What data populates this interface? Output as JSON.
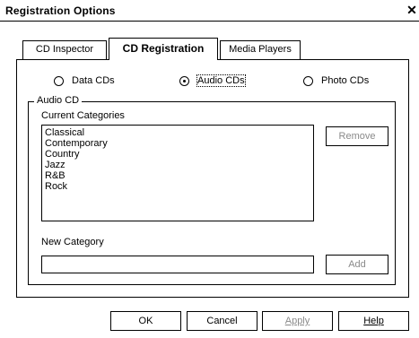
{
  "window": {
    "title": "Registration Options",
    "close_glyph": "✕"
  },
  "tabs": [
    {
      "label": "CD Inspector",
      "active": false
    },
    {
      "label": "CD Registration",
      "active": true
    },
    {
      "label": "Media Players",
      "active": false
    }
  ],
  "disc_type": {
    "options": [
      {
        "label": "Data CDs",
        "checked": false
      },
      {
        "label": "Audio CDs",
        "checked": true
      },
      {
        "label": "Photo CDs",
        "checked": false
      }
    ]
  },
  "audio_cd": {
    "group_label": "Audio CD",
    "current_categories_label": "Current Categories",
    "categories": [
      "Classical",
      "Contemporary",
      "Country",
      "Jazz",
      "R&B",
      "Rock"
    ],
    "remove_label": "Remove",
    "new_category_label": "New Category",
    "new_category_value": "",
    "add_label": "Add"
  },
  "footer": {
    "ok_label": "OK",
    "cancel_label": "Cancel",
    "apply_label": "Apply",
    "help_label": "Help"
  },
  "colors": {
    "background": "#ffffff",
    "border": "#000000",
    "disabled_text": "#8a8a8a"
  }
}
